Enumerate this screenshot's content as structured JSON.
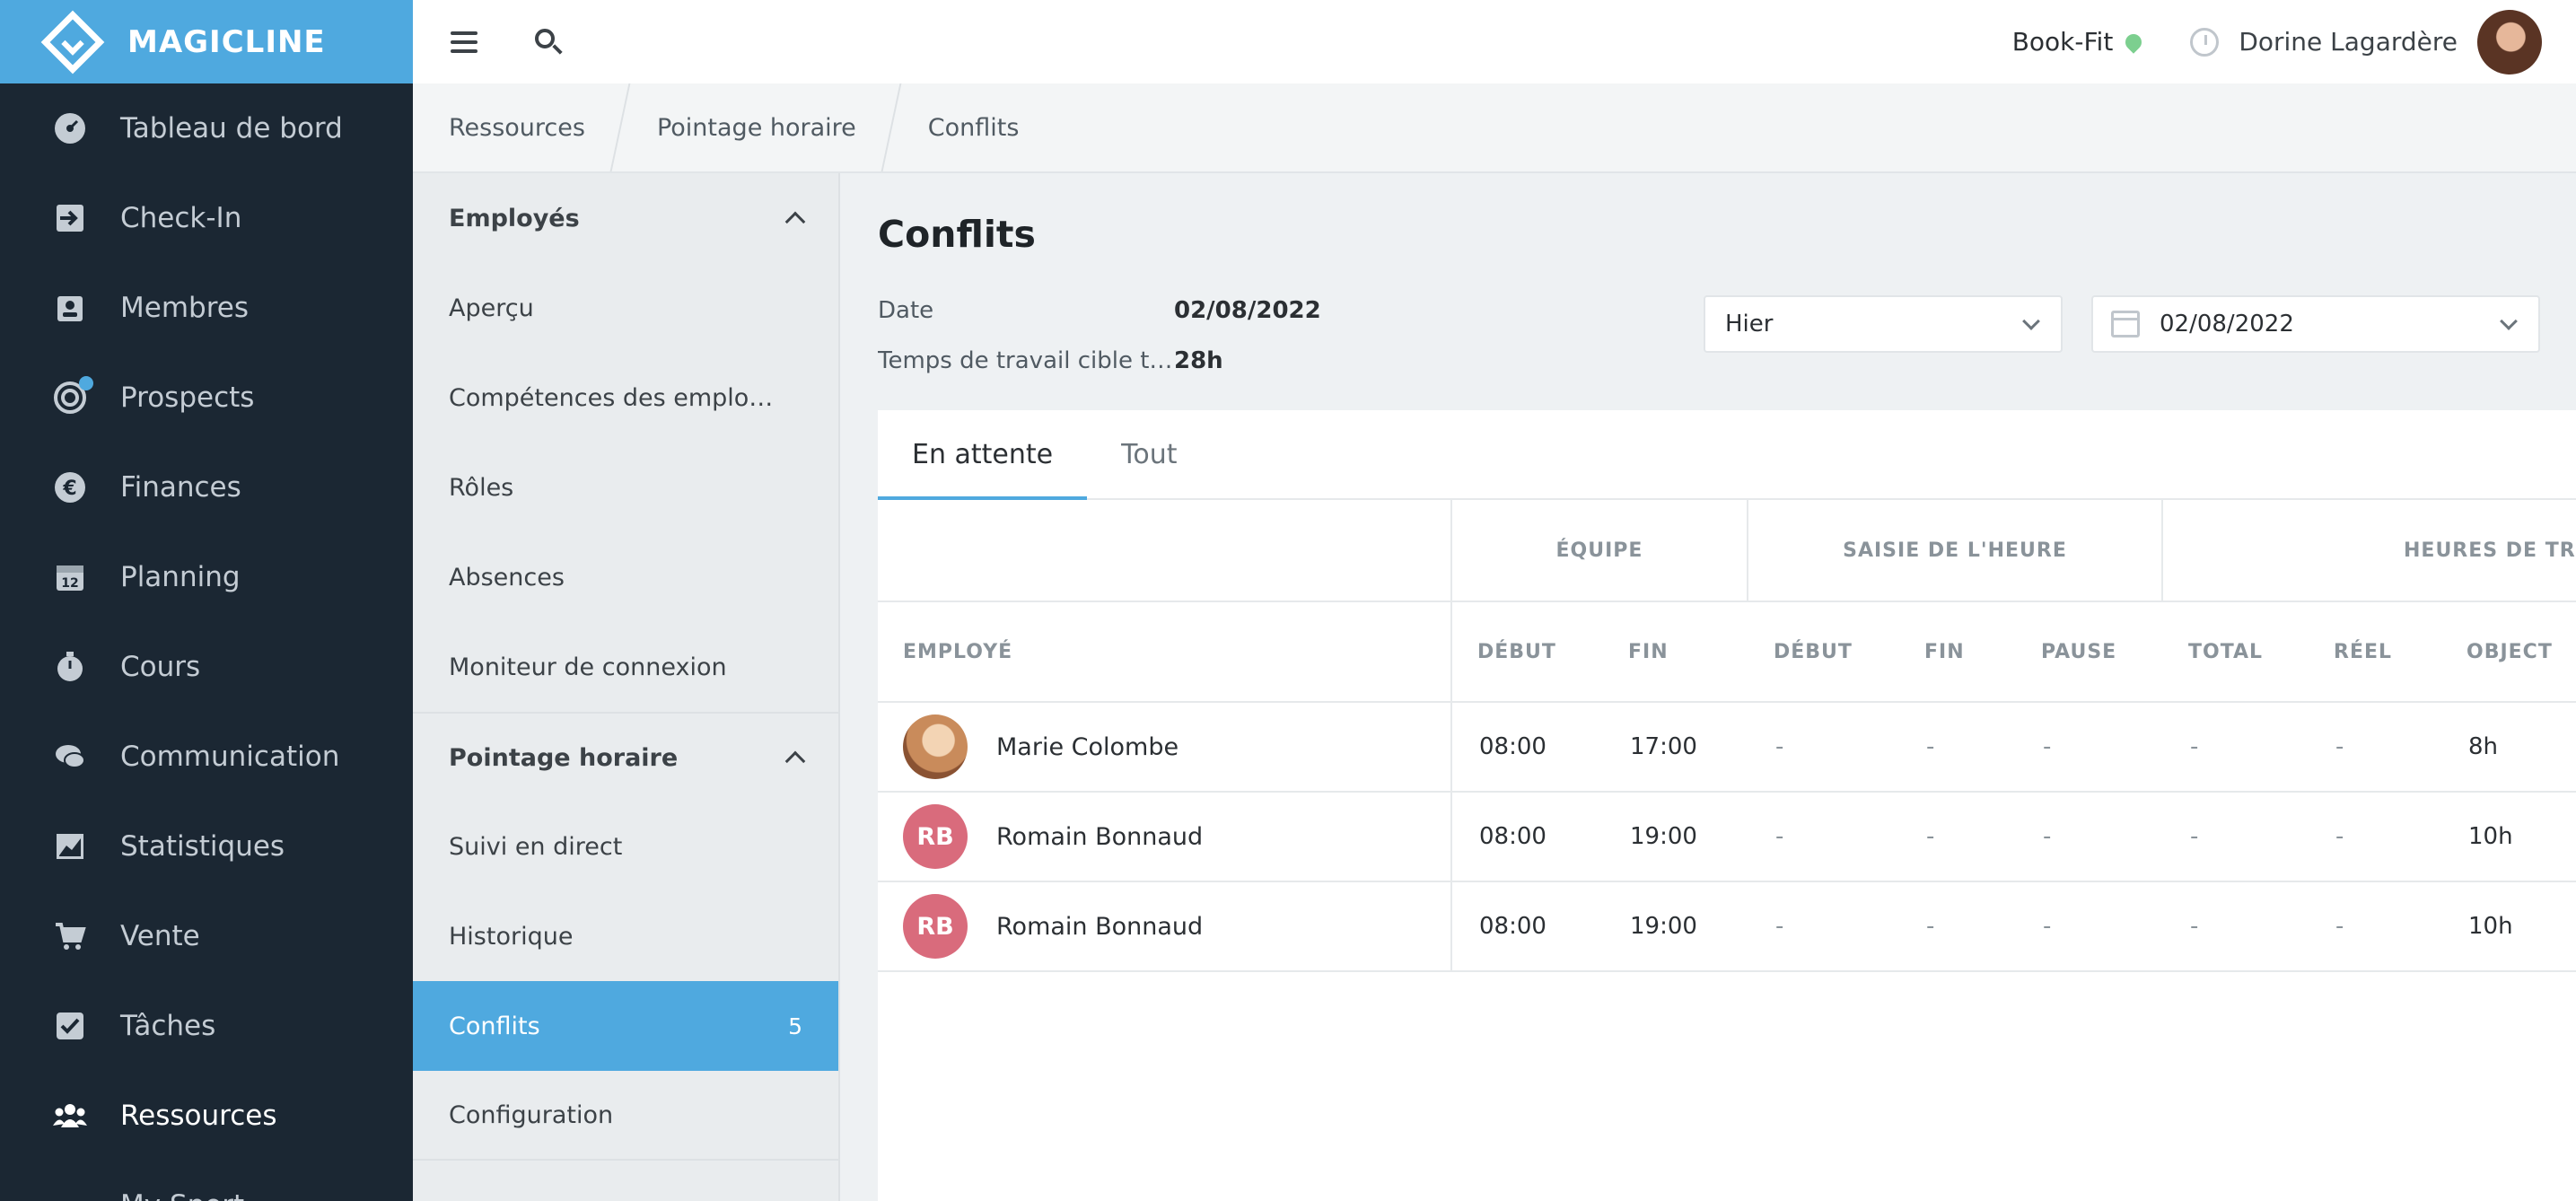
{
  "brand": {
    "name": "MAGICLINE"
  },
  "nav": {
    "items": [
      {
        "label": "Tableau de bord",
        "icon": "dashboard-icon",
        "active": false
      },
      {
        "label": "Check-In",
        "icon": "check-in-icon",
        "active": false
      },
      {
        "label": "Membres",
        "icon": "members-icon",
        "active": false
      },
      {
        "label": "Prospects",
        "icon": "prospects-icon",
        "active": false,
        "dot": true
      },
      {
        "label": "Finances",
        "icon": "euro-icon",
        "active": false
      },
      {
        "label": "Planning",
        "icon": "calendar-icon",
        "calendar_day": "12",
        "active": false
      },
      {
        "label": "Cours",
        "icon": "stopwatch-icon",
        "active": false
      },
      {
        "label": "Communication",
        "icon": "chat-icon",
        "active": false
      },
      {
        "label": "Statistiques",
        "icon": "chart-icon",
        "active": false
      },
      {
        "label": "Vente",
        "icon": "cart-icon",
        "active": false
      },
      {
        "label": "Tâches",
        "icon": "task-check-icon",
        "active": false
      },
      {
        "label": "Ressources",
        "icon": "people-icon",
        "active": true
      },
      {
        "label": "My Sport...",
        "icon": "more-icon",
        "active": false
      }
    ]
  },
  "topbar": {
    "studio": "Book-Fit",
    "user_name": "Dorine Lagardère"
  },
  "breadcrumb": [
    "Ressources",
    "Pointage horaire",
    "Conflits"
  ],
  "subnav": {
    "sections": [
      {
        "title": "Employés",
        "items": [
          {
            "label": "Aperçu"
          },
          {
            "label": "Compétences des emplo…"
          },
          {
            "label": "Rôles"
          },
          {
            "label": "Absences"
          },
          {
            "label": "Moniteur de connexion"
          }
        ]
      },
      {
        "title": "Pointage horaire",
        "items": [
          {
            "label": "Suivi en direct"
          },
          {
            "label": "Historique"
          },
          {
            "label": "Conflits",
            "badge": "5",
            "active": true
          },
          {
            "label": "Configuration"
          }
        ]
      }
    ]
  },
  "main": {
    "title": "Conflits",
    "date_label": "Date",
    "date_value": "02/08/2022",
    "target_label": "Temps de travail cible t…",
    "target_value": "28h",
    "period_select": "Hier",
    "date_picker": "02/08/2022",
    "tabs": [
      {
        "label": "En attente",
        "active": true
      },
      {
        "label": "Tout",
        "active": false
      }
    ],
    "groups": {
      "team": "ÉQUIPE",
      "time_entry": "SAISIE DE L'HEURE",
      "work_hours": "HEURES DE TR"
    },
    "columns": {
      "employee": "EMPLOYÉ",
      "team_start": "DÉBUT",
      "team_end": "FIN",
      "entry_start": "DÉBUT",
      "entry_end": "FIN",
      "pause": "PAUSE",
      "total": "TOTAL",
      "real": "RÉEL",
      "target": "OBJECT"
    },
    "rows": [
      {
        "initials": "",
        "photo": true,
        "name": "Marie Colombe",
        "team_start": "08:00",
        "team_end": "17:00",
        "entry_start": "-",
        "entry_end": "-",
        "pause": "-",
        "total": "-",
        "real": "-",
        "target": "8h"
      },
      {
        "initials": "RB",
        "photo": false,
        "name": "Romain Bonnaud",
        "team_start": "08:00",
        "team_end": "19:00",
        "entry_start": "-",
        "entry_end": "-",
        "pause": "-",
        "total": "-",
        "real": "-",
        "target": "10h"
      },
      {
        "initials": "RB",
        "photo": false,
        "name": "Romain Bonnaud",
        "team_start": "08:00",
        "team_end": "19:00",
        "entry_start": "-",
        "entry_end": "-",
        "pause": "-",
        "total": "-",
        "real": "-",
        "target": "10h"
      }
    ]
  },
  "colors": {
    "nav_bg": "#1b2733",
    "accent": "#4fa9df",
    "avatar_initials_bg": "#d96b7c",
    "location_pin": "#7ccf8f"
  }
}
